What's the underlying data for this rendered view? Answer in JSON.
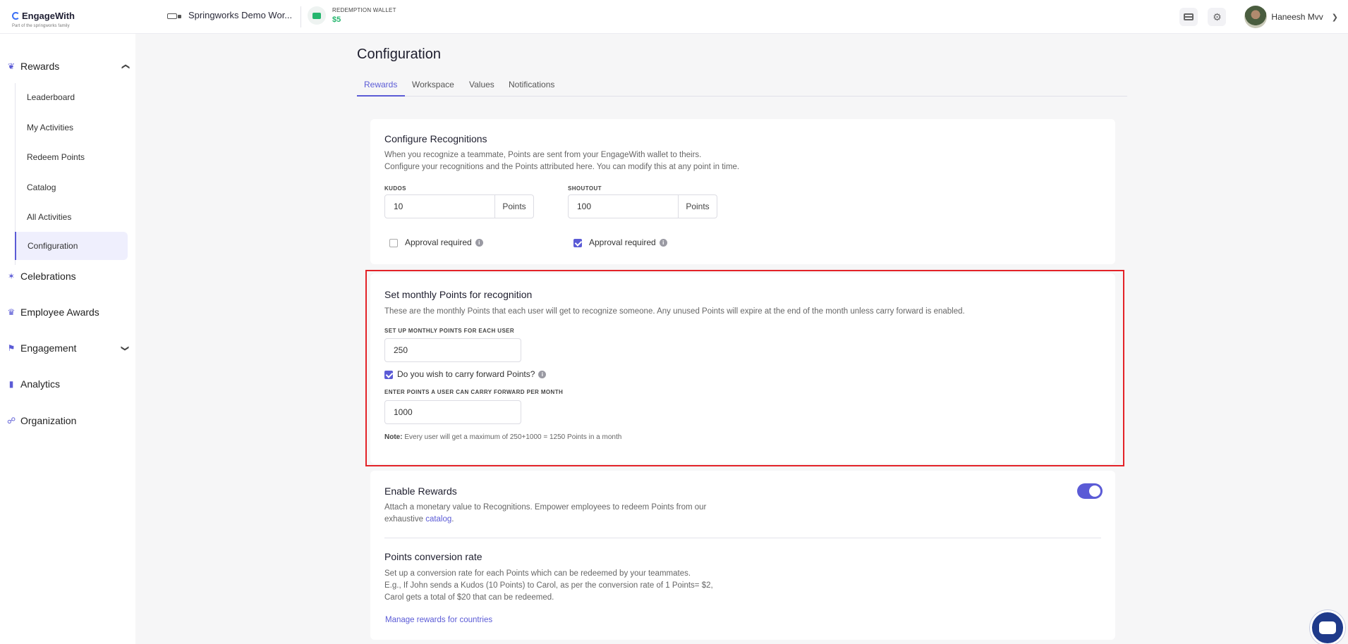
{
  "topbar": {
    "brand": "EngageWith",
    "tagline": "Part of the springworks family",
    "workspace": "Springworks Demo Wor...",
    "wallet_label": "REDEMPTION WALLET",
    "wallet_amount": "$5",
    "user_name": "Haneesh Mvv"
  },
  "sidebar": {
    "rewards": "Rewards",
    "sub": [
      "Leaderboard",
      "My Activities",
      "Redeem Points",
      "Catalog",
      "All Activities",
      "Configuration"
    ],
    "celebrations": "Celebrations",
    "employee_awards": "Employee Awards",
    "engagement": "Engagement",
    "analytics": "Analytics",
    "organization": "Organization"
  },
  "page": {
    "title": "Configuration",
    "tabs": [
      "Rewards",
      "Workspace",
      "Values",
      "Notifications"
    ],
    "active_tab": "Rewards"
  },
  "recognitions": {
    "title": "Configure Recognitions",
    "desc1": "When you recognize a teammate, Points are sent from your EngageWith wallet to theirs.",
    "desc2": "Configure your recognitions and the Points attributed here. You can modify this at any point in time.",
    "kudos_label": "KUDOS",
    "kudos_value": "10",
    "shoutout_label": "SHOUTOUT",
    "shoutout_value": "100",
    "unit": "Points",
    "approval_label": "Approval required",
    "kudos_approval": false,
    "shoutout_approval": true
  },
  "monthly": {
    "title": "Set monthly Points for recognition",
    "desc": "These are the monthly Points that each user will get to recognize someone. Any unused Points will expire at the end of the month unless carry forward is enabled.",
    "setup_label": "SET UP MONTHLY POINTS FOR EACH USER",
    "setup_value": "250",
    "carry_label": "Do you wish to carry forward Points?",
    "carry_checked": true,
    "carry_field_label": "ENTER POINTS A USER CAN CARRY FORWARD PER MONTH",
    "carry_value": "1000",
    "note_prefix": "Note:",
    "note_text": "Every user will get a maximum of 250+1000 = 1250 Points in a month"
  },
  "rewards_card": {
    "title": "Enable Rewards",
    "desc1": "Attach a monetary value to Recognitions. Empower employees to redeem Points from our",
    "desc2_prefix": "exhaustive",
    "desc2_link": "catalog",
    "desc2_suffix": ".",
    "enabled": true,
    "conv_title": "Points conversion rate",
    "conv_desc1": "Set up a conversion rate for each Points which can be redeemed by your teammates.",
    "conv_desc2": "E.g., If John sends a Kudos (10 Points) to Carol, as per the conversion rate of 1 Points= $2,",
    "conv_desc3": "Carol gets a total of $20 that can be redeemed.",
    "manage_link": "Manage rewards for countries"
  },
  "colors": {
    "accent": "#5b5bd6",
    "wallet_green": "#25b66e",
    "highlight_red": "#e32228"
  }
}
